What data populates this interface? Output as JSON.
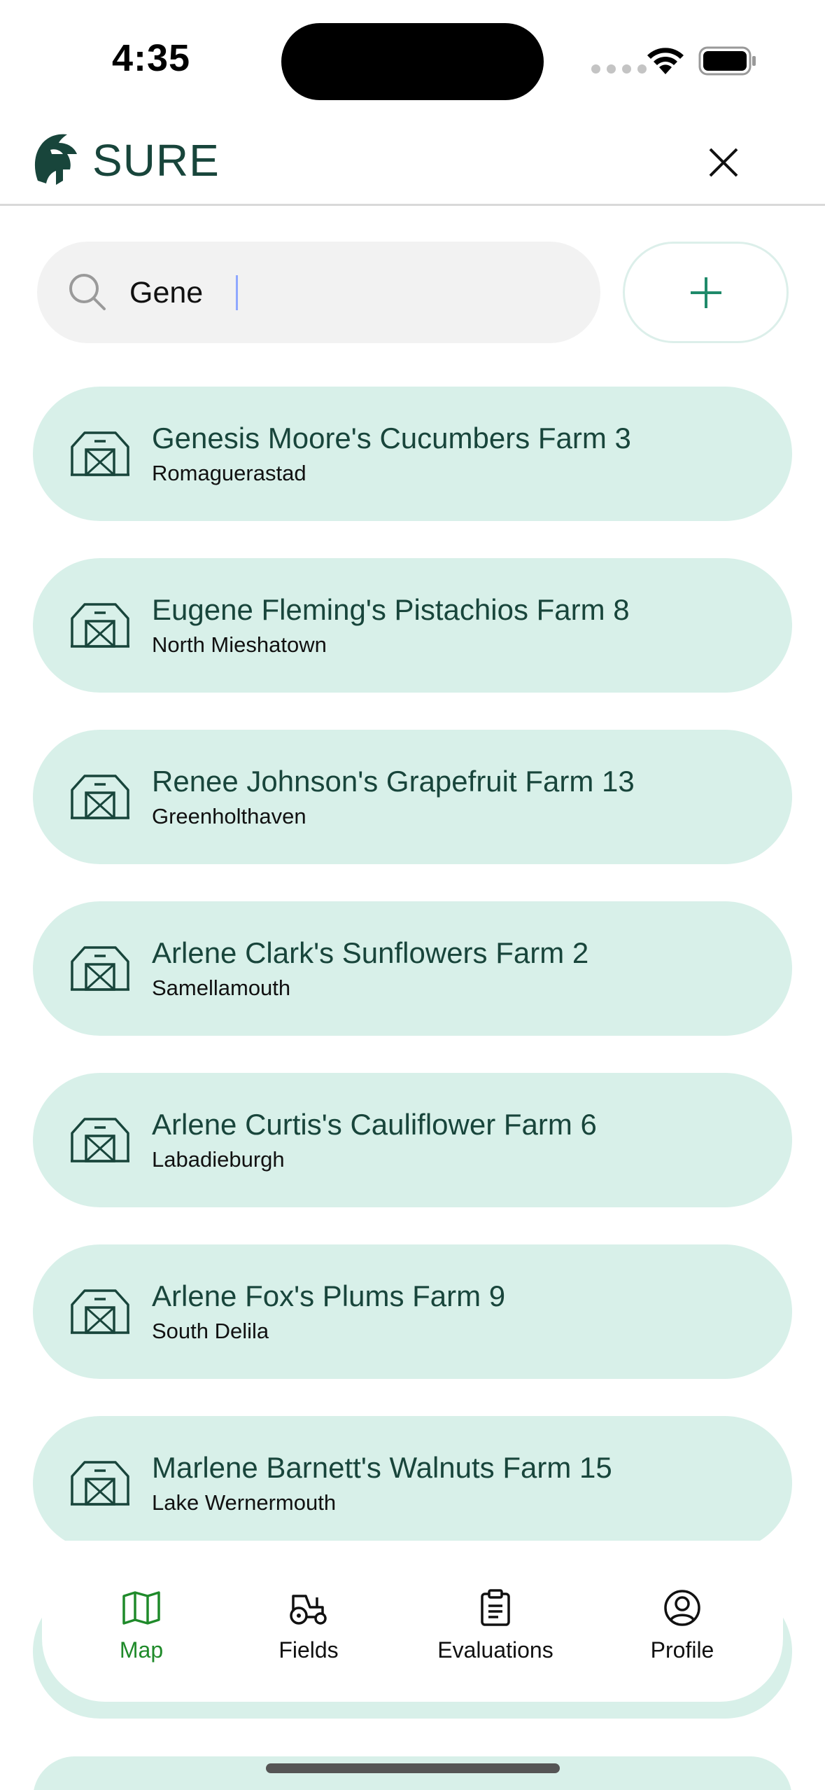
{
  "status_bar": {
    "time": "4:35"
  },
  "header": {
    "title": "SURE"
  },
  "search": {
    "value": "Gene",
    "placeholder": ""
  },
  "farms": [
    {
      "name": "Genesis Moore's Cucumbers Farm 3",
      "location": "Romaguerastad"
    },
    {
      "name": "Eugene Fleming's Pistachios Farm 8",
      "location": "North Mieshatown"
    },
    {
      "name": "Renee Johnson's Grapefruit Farm 13",
      "location": "Greenholthaven"
    },
    {
      "name": "Arlene Clark's Sunflowers Farm 2",
      "location": "Samellamouth"
    },
    {
      "name": "Arlene Curtis's Cauliflower Farm 6",
      "location": "Labadieburgh"
    },
    {
      "name": "Arlene Fox's Plums Farm 9",
      "location": "South Delila"
    },
    {
      "name": "Marlene Barnett's Walnuts Farm 15",
      "location": "Lake Wernermouth"
    }
  ],
  "nav": {
    "items": [
      {
        "label": "Map",
        "icon": "map-icon",
        "active": true
      },
      {
        "label": "Fields",
        "icon": "tractor-icon",
        "active": false
      },
      {
        "label": "Evaluations",
        "icon": "clipboard-icon",
        "active": false
      },
      {
        "label": "Profile",
        "icon": "profile-icon",
        "active": false
      }
    ]
  },
  "colors": {
    "brand": "#18453b",
    "card": "#d8f0e9",
    "accent": "#1f8a6a",
    "active_nav": "#1f8a2a"
  }
}
